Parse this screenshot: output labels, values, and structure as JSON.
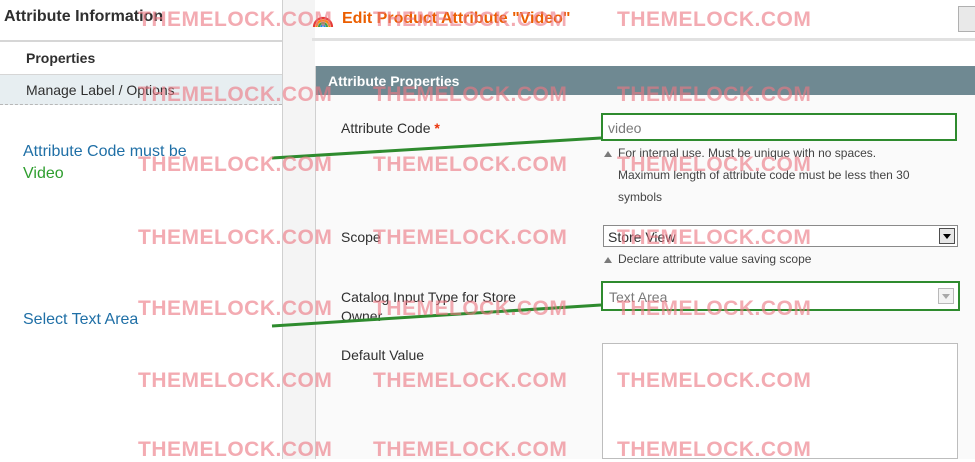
{
  "sidebar": {
    "title": "Attribute Information",
    "tabs": [
      {
        "label": "Properties"
      },
      {
        "label": "Manage Label / Options"
      }
    ]
  },
  "notes": {
    "code_line1": "Attribute Code must be",
    "code_line2": "Video",
    "input_type": "Select Text Area"
  },
  "header": {
    "title": "Edit Product Attribute \"Video\""
  },
  "fieldset": {
    "legend": "Attribute Properties",
    "attribute_code": {
      "label": "Attribute Code",
      "required_mark": "*",
      "value": "video",
      "hint_line1": "For internal use. Must be unique with no spaces.",
      "hint_line2": "Maximum length of attribute code must be less then 30",
      "hint_line3": "symbols"
    },
    "scope": {
      "label": "Scope",
      "value": "Store View",
      "hint": "Declare attribute value saving scope"
    },
    "input_type": {
      "label_line1": "Catalog Input Type for Store",
      "label_line2": "Owner",
      "value": "Text Area"
    },
    "default_value": {
      "label": "Default Value",
      "value": ""
    }
  },
  "watermark": "THEMELOCK.COM",
  "colors": {
    "header_title": "#eb5e00",
    "legend_bg": "#6f8992",
    "note_blue": "#1f6fa6",
    "note_green": "#2e9e2e",
    "highlight_green": "#2e8b2e",
    "watermark": "#ec7882",
    "required": "#eb340a"
  },
  "icons": {
    "header": "rainbow-icon",
    "select_arrow": "chevron-down-icon",
    "hint": "triangle-up-icon"
  }
}
